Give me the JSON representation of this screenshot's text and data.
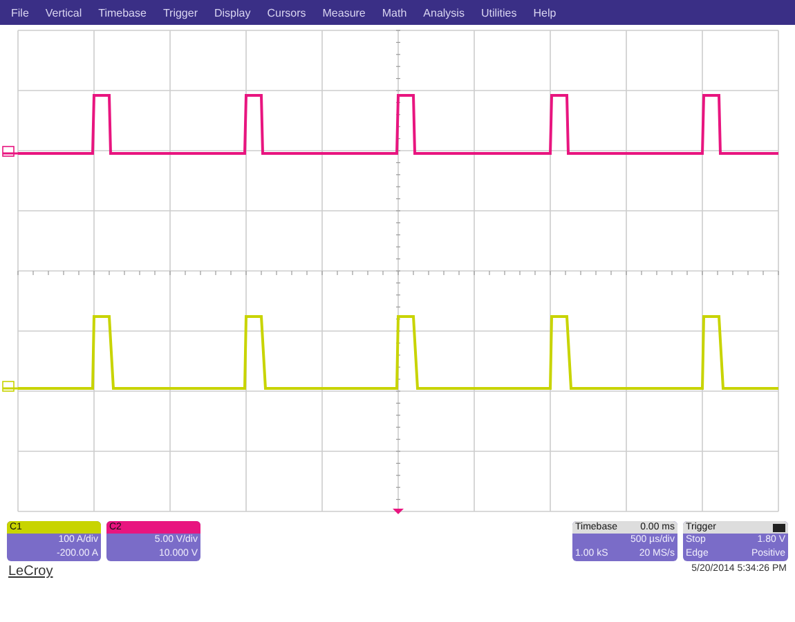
{
  "menu": [
    {
      "label": "File"
    },
    {
      "label": "Vertical"
    },
    {
      "label": "Timebase"
    },
    {
      "label": "Trigger"
    },
    {
      "label": "Display"
    },
    {
      "label": "Cursors"
    },
    {
      "label": "Measure"
    },
    {
      "label": "Math"
    },
    {
      "label": "Analysis"
    },
    {
      "label": "Utilities"
    },
    {
      "label": "Help"
    }
  ],
  "channels": [
    {
      "name": "C1",
      "color": "#c8d400",
      "scale": "100 A/div",
      "offset": "-200.00 A"
    },
    {
      "name": "C2",
      "color": "#e8157f",
      "scale": "5.00 V/div",
      "offset": "10.000 V"
    }
  ],
  "timebase": {
    "title": "Timebase",
    "delay": "0.00 ms",
    "scale": "500 µs/div",
    "samples": "1.00 kS",
    "rate": "20 MS/s"
  },
  "trigger": {
    "title": "Trigger",
    "mode": "Stop",
    "level": "1.80 V",
    "type": "Edge",
    "slope": "Positive"
  },
  "brand": "LeCroy",
  "timestamp": "5/20/2014 5:34:26 PM"
}
